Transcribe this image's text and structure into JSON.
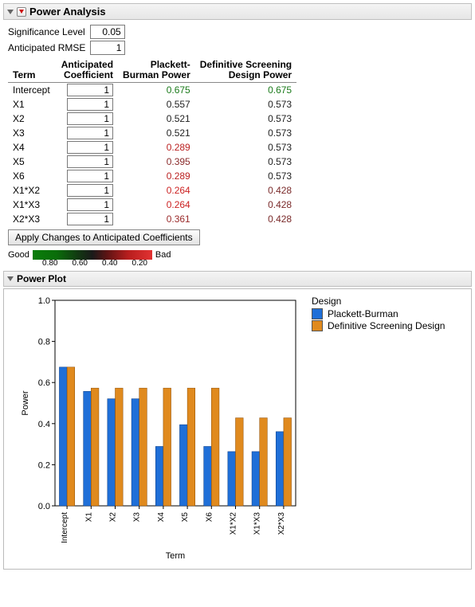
{
  "panel1": {
    "title": "Power Analysis",
    "sig_label": "Significance Level",
    "sig_value": "0.05",
    "rmse_label": "Anticipated RMSE",
    "rmse_value": "1",
    "headers": {
      "term": "Term",
      "coef_l1": "Anticipated",
      "coef_l2": "Coefficient",
      "pb_l1": "Plackett-",
      "pb_l2": "Burman Power",
      "dsd_l1": "Definitive Screening",
      "dsd_l2": "Design Power"
    },
    "rows": [
      {
        "term": "Intercept",
        "coef": "1",
        "pb": "0.675",
        "dsd": "0.675",
        "pbcol": "#1a7a1a",
        "dsdcol": "#1a7a1a"
      },
      {
        "term": "X1",
        "coef": "1",
        "pb": "0.557",
        "dsd": "0.573",
        "pbcol": "#222",
        "dsdcol": "#222"
      },
      {
        "term": "X2",
        "coef": "1",
        "pb": "0.521",
        "dsd": "0.573",
        "pbcol": "#222",
        "dsdcol": "#222"
      },
      {
        "term": "X3",
        "coef": "1",
        "pb": "0.521",
        "dsd": "0.573",
        "pbcol": "#222",
        "dsdcol": "#222"
      },
      {
        "term": "X4",
        "coef": "1",
        "pb": "0.289",
        "dsd": "0.573",
        "pbcol": "#b22",
        "dsdcol": "#222"
      },
      {
        "term": "X5",
        "coef": "1",
        "pb": "0.395",
        "dsd": "0.573",
        "pbcol": "#8a2a2a",
        "dsdcol": "#222"
      },
      {
        "term": "X6",
        "coef": "1",
        "pb": "0.289",
        "dsd": "0.573",
        "pbcol": "#b22",
        "dsdcol": "#222"
      },
      {
        "term": "X1*X2",
        "coef": "1",
        "pb": "0.264",
        "dsd": "0.428",
        "pbcol": "#c22",
        "dsdcol": "#7a2a2a"
      },
      {
        "term": "X1*X3",
        "coef": "1",
        "pb": "0.264",
        "dsd": "0.428",
        "pbcol": "#c22",
        "dsdcol": "#7a2a2a"
      },
      {
        "term": "X2*X3",
        "coef": "1",
        "pb": "0.361",
        "dsd": "0.428",
        "pbcol": "#9a2a2a",
        "dsdcol": "#7a2a2a"
      }
    ],
    "apply_btn": "Apply Changes to Anticipated Coefficients",
    "good": "Good",
    "bad": "Bad",
    "ticks": [
      "0.80",
      "0.60",
      "0.40",
      "0.20"
    ]
  },
  "panel2": {
    "title": "Power Plot",
    "ylab": "Power",
    "xlab": "Term",
    "legend_title": "Design",
    "legend_items": [
      "Plackett-Burman",
      "Definitive Screening Design"
    ]
  },
  "chart_data": {
    "type": "bar",
    "categories": [
      "Intercept",
      "X1",
      "X2",
      "X3",
      "X4",
      "X5",
      "X6",
      "X1*X2",
      "X1*X3",
      "X2*X3"
    ],
    "series": [
      {
        "name": "Plackett-Burman",
        "color": "#1f6fd8",
        "values": [
          0.675,
          0.557,
          0.521,
          0.521,
          0.289,
          0.395,
          0.289,
          0.264,
          0.264,
          0.361
        ]
      },
      {
        "name": "Definitive Screening Design",
        "color": "#e08a1e",
        "values": [
          0.675,
          0.573,
          0.573,
          0.573,
          0.573,
          0.573,
          0.573,
          0.428,
          0.428,
          0.428
        ]
      }
    ],
    "ylim": [
      0,
      1.0
    ],
    "yticks": [
      0.0,
      0.2,
      0.4,
      0.6,
      0.8,
      1.0
    ],
    "xlabel": "Term",
    "ylabel": "Power",
    "legend": {
      "title": "Design",
      "position": "right"
    }
  },
  "colors": {
    "pb": "#1f6fd8",
    "dsd": "#e08a1e"
  }
}
